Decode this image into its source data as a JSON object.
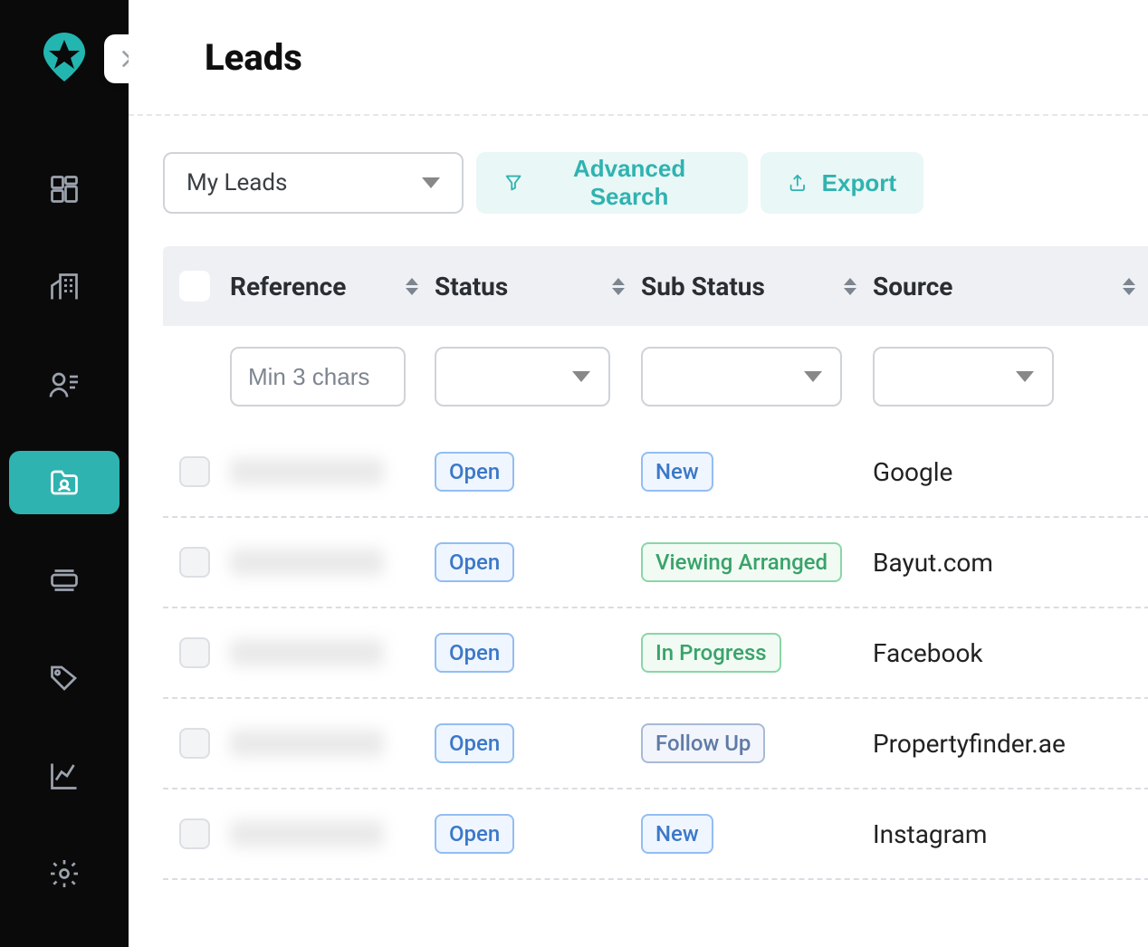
{
  "header": {
    "title": "Leads"
  },
  "toolbar": {
    "view_label": "My Leads",
    "adv_search_label": "Advanced Search",
    "export_label": "Export"
  },
  "table": {
    "columns": {
      "reference": "Reference",
      "status": "Status",
      "sub_status": "Sub Status",
      "source": "Source"
    },
    "filters": {
      "reference_placeholder": "Min 3 chars"
    },
    "rows": [
      {
        "status": "Open",
        "sub_status": "New",
        "sub_style": "blue",
        "source": "Google"
      },
      {
        "status": "Open",
        "sub_status": "Viewing Arranged",
        "sub_style": "green",
        "source": "Bayut.com"
      },
      {
        "status": "Open",
        "sub_status": "In Progress",
        "sub_style": "green",
        "source": "Facebook"
      },
      {
        "status": "Open",
        "sub_status": "Follow Up",
        "sub_style": "slate",
        "source": "Propertyfinder.ae"
      },
      {
        "status": "Open",
        "sub_status": "New",
        "sub_style": "blue",
        "source": "Instagram"
      }
    ]
  }
}
